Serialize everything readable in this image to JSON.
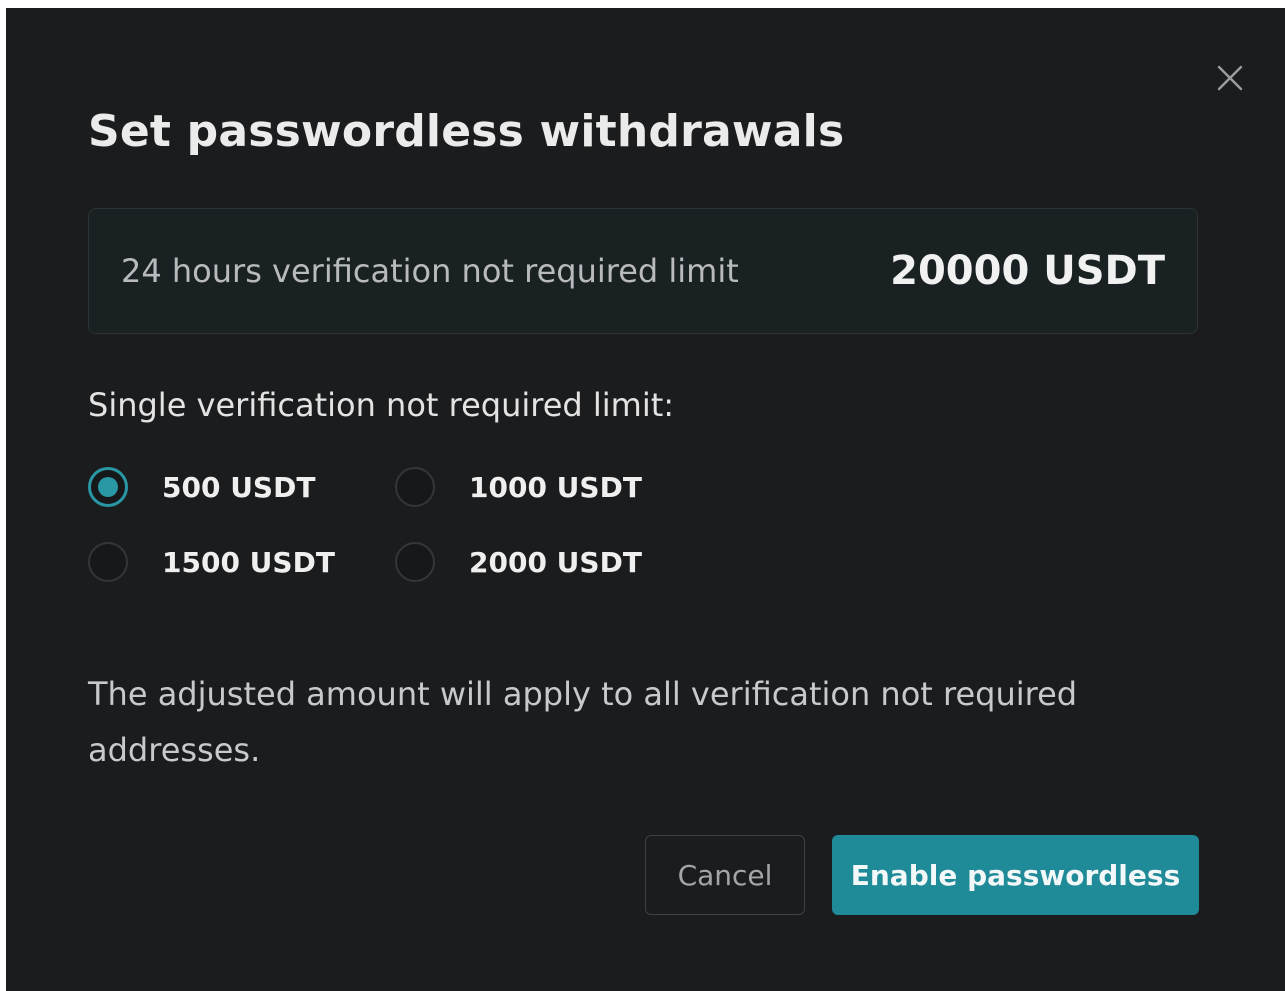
{
  "dialog": {
    "title": "Set passwordless withdrawals",
    "close_icon": "close-icon",
    "daily_limit": {
      "label": "24 hours verification not required limit",
      "value": "20000 USDT"
    },
    "single_limit": {
      "label": "Single verification not required limit:",
      "selected": "500 USDT",
      "options": [
        {
          "label": "500 USDT",
          "checked": true
        },
        {
          "label": "1000 USDT",
          "checked": false
        },
        {
          "label": "1500 USDT",
          "checked": false
        },
        {
          "label": "2000 USDT",
          "checked": false
        }
      ]
    },
    "note": "The adjusted amount will apply to all verification not required addresses.",
    "buttons": {
      "cancel": "Cancel",
      "enable": "Enable passwordless"
    }
  },
  "colors": {
    "background": "#1b1c1e",
    "accent": "#1f8a98",
    "radio_checked": "#2a97a4",
    "limit_box": "#1a2123"
  }
}
